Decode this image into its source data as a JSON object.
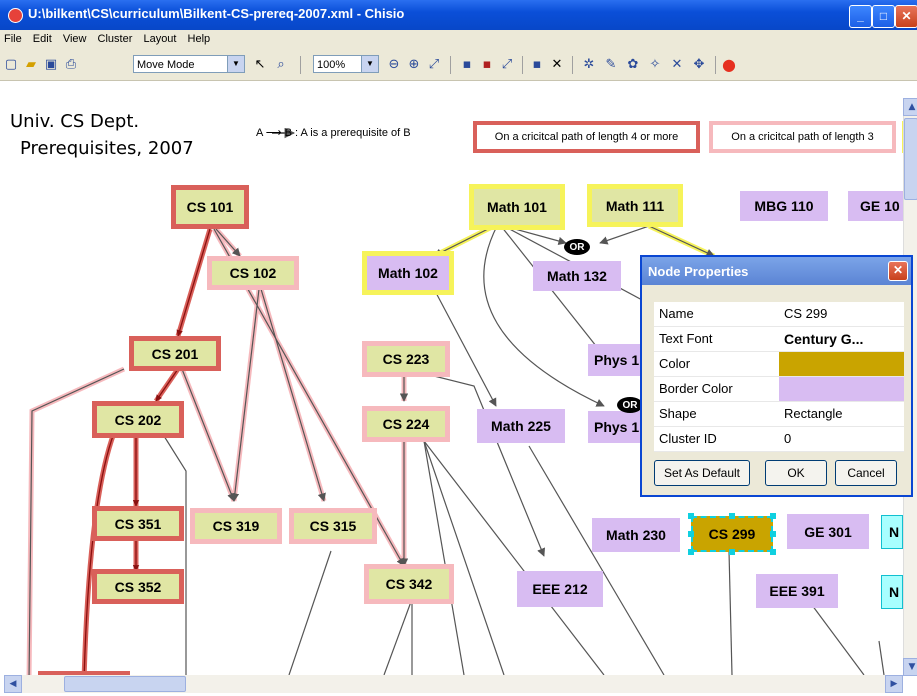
{
  "window": {
    "title": "U:\\bilkent\\CS\\curriculum\\Bilkent-CS-prereq-2007.xml - Chisio"
  },
  "menu": [
    "File",
    "Edit",
    "View",
    "Cluster",
    "Layout",
    "Help"
  ],
  "toolbar": {
    "mode": "Move Mode",
    "zoom": "100%"
  },
  "diagram": {
    "heading1": "Univ. CS Dept.",
    "heading2": "Prerequisites, 2007",
    "legend_arrow": "A ⟶ B : A is a prerequisite of B",
    "legend_red": "On a cricitcal path of length 4 or more",
    "legend_pink": "On a cricitcal path of length 3",
    "or_label": "OR",
    "nodes": {
      "cs101": "CS 101",
      "cs102": "CS 102",
      "cs201": "CS 201",
      "cs202": "CS 202",
      "cs351": "CS 351",
      "cs352": "CS 352",
      "cs319": "CS 319",
      "cs315": "CS 315",
      "cs223": "CS 223",
      "cs224": "CS 224",
      "cs342": "CS 342",
      "math101": "Math 101",
      "math111": "Math 111",
      "math102": "Math 102",
      "math132": "Math 132",
      "math225": "Math 225",
      "math230": "Math 230",
      "mbg110": "MBG 110",
      "ge10": "GE 10",
      "phys1": "Phys 1",
      "phys2": "Phys 1",
      "cs299": "CS 299",
      "ge301": "GE 301",
      "eee212": "EEE 212",
      "eee391": "EEE 391",
      "cyan1": "N",
      "cyan2": "N"
    }
  },
  "dialog": {
    "title": "Node Properties",
    "rows": [
      {
        "key": "Name",
        "value": "CS 299"
      },
      {
        "key": "Text Font",
        "value": "Century G..."
      },
      {
        "key": "Color",
        "value": ""
      },
      {
        "key": "Border Color",
        "value": ""
      },
      {
        "key": "Shape",
        "value": "Rectangle"
      },
      {
        "key": "Cluster ID",
        "value": "0"
      }
    ],
    "color_value": "#c9a400",
    "border_color_value": "#d8bcf2",
    "set_default": "Set As Default",
    "ok": "OK",
    "cancel": "Cancel"
  },
  "colors": {
    "titlebar": "#0a4fd8",
    "critical_red": "#d9605a",
    "critical_pink": "#f6b9bd",
    "highlight_yellow": "#f6f35a",
    "node_green": "#e0e6a4",
    "node_purple": "#d8bcf2",
    "selected_node": "#c9a400"
  }
}
